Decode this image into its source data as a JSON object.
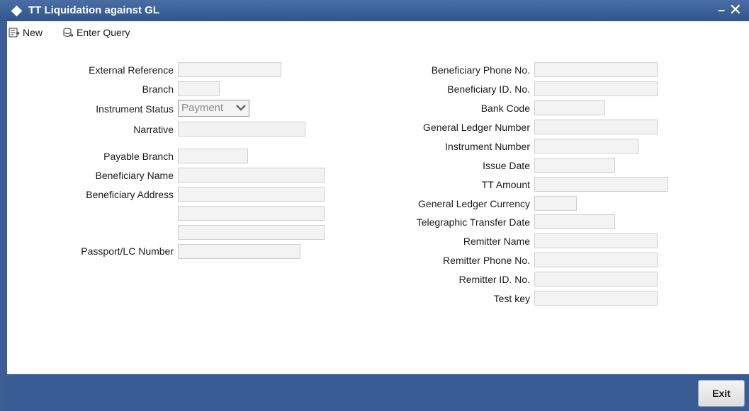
{
  "window": {
    "title": "TT Liquidation against GL"
  },
  "toolbar": {
    "new_label": "New",
    "enter_query_label": "Enter Query"
  },
  "left_fields": {
    "external_reference": "External Reference",
    "branch": "Branch",
    "instrument_status": "Instrument Status",
    "narrative": "Narrative",
    "payable_branch": "Payable Branch",
    "beneficiary_name": "Beneficiary Name",
    "beneficiary_address": "Beneficiary Address",
    "passport_lc_number": "Passport/LC Number"
  },
  "instrument_status_value": "Payment",
  "right_fields": {
    "beneficiary_phone": "Beneficiary Phone No.",
    "beneficiary_id": "Beneficiary ID. No.",
    "bank_code": "Bank Code",
    "general_ledger_number": "General Ledger Number",
    "instrument_number": "Instrument Number",
    "issue_date": "Issue Date",
    "tt_amount": "TT Amount",
    "general_ledger_currency": "General Ledger Currency",
    "telegraphic_transfer_date": "Telegraphic Transfer Date",
    "remitter_name": "Remitter Name",
    "remitter_phone": "Remitter Phone No.",
    "remitter_id": "Remitter ID. No.",
    "test_key": "Test key"
  },
  "footer": {
    "exit_label": "Exit"
  },
  "colors": {
    "titlebar": "#3d5e93",
    "footer": "#3a5c95",
    "field_bg": "#f3f3f3"
  }
}
